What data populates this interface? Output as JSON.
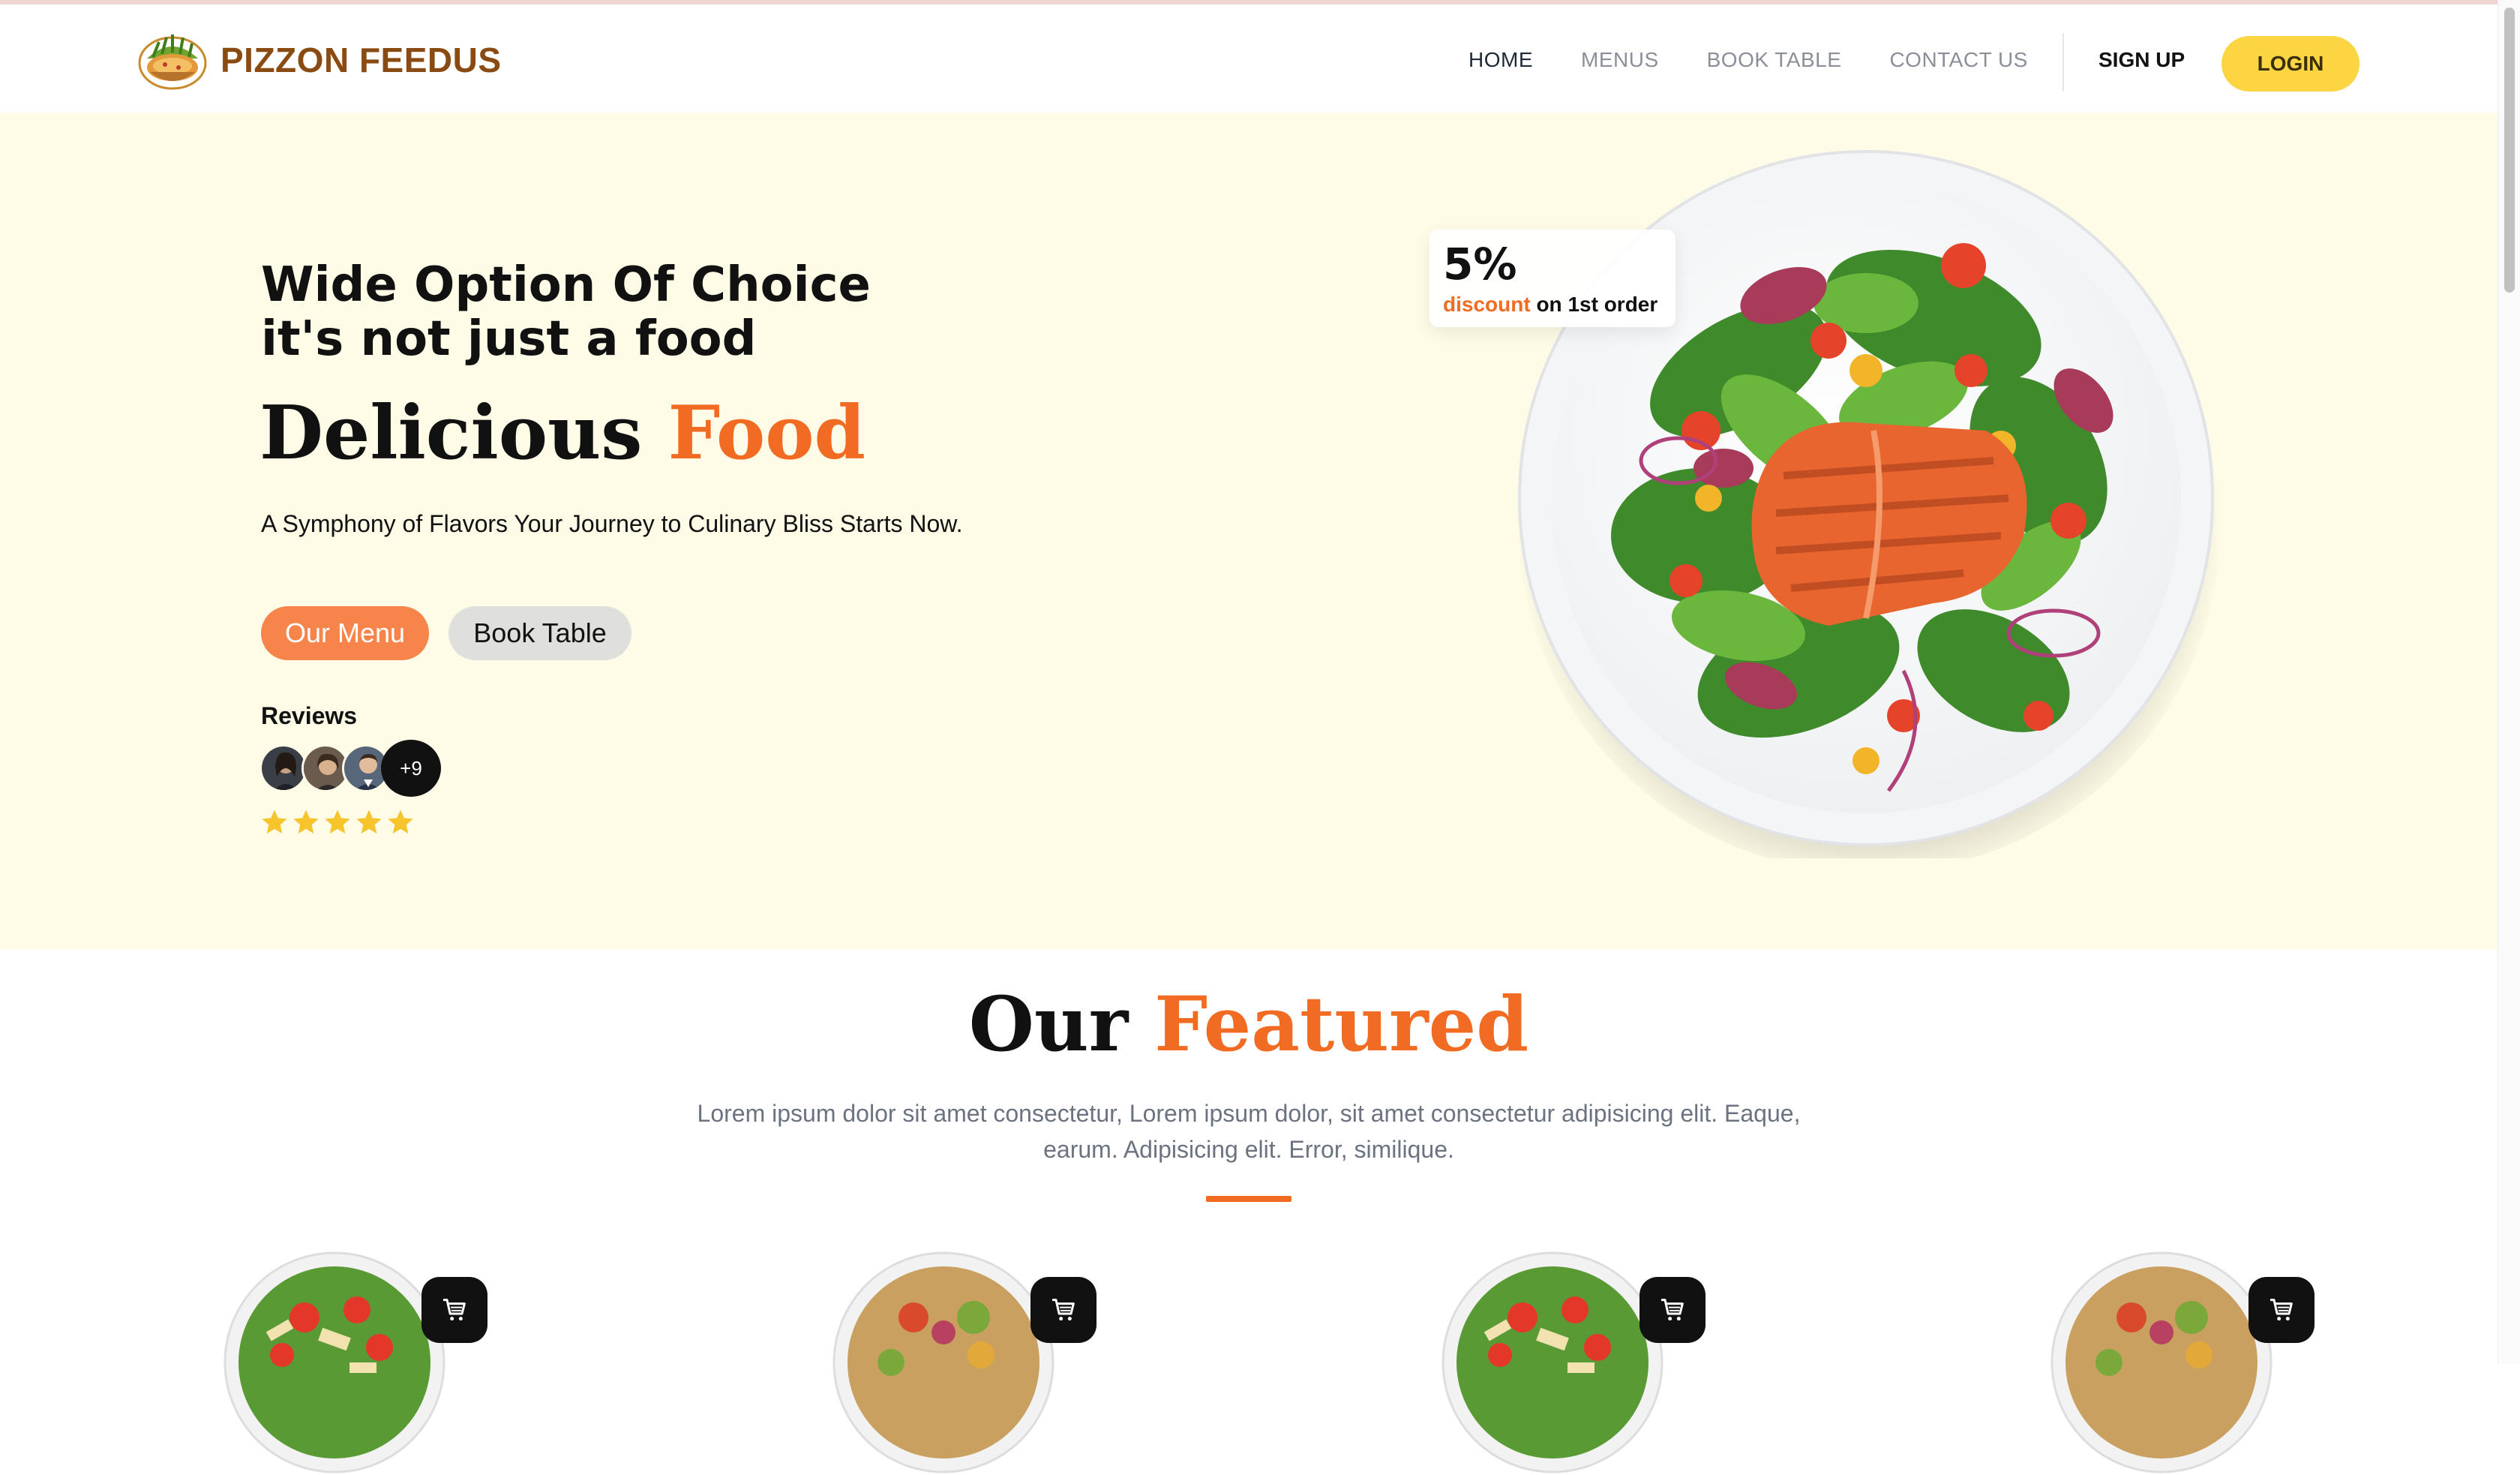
{
  "brand": {
    "name": "PIZZON FEEDUS",
    "logo_icon": "pizza-basket-logo-icon"
  },
  "nav": {
    "links": [
      {
        "label": "HOME",
        "active": true
      },
      {
        "label": "MENUS",
        "active": false
      },
      {
        "label": "BOOK TABLE",
        "active": false
      },
      {
        "label": "CONTACT US",
        "active": false
      }
    ],
    "signup": "SIGN UP",
    "login": "LOGIN"
  },
  "hero": {
    "tagline_1": "Wide Option Of Choice",
    "tagline_2": "it's not just a food",
    "headline_1": "Delicious",
    "headline_2": "Food",
    "subtext": "A Symphony of Flavors Your Journey to Culinary Bliss Starts Now.",
    "btn_menu": "Our Menu",
    "btn_book": "Book Table",
    "reviews_label": "Reviews",
    "reviewers_more": "+9",
    "rating_stars": 5,
    "discount": {
      "pct": "5%",
      "word": "discount",
      "rest": "on 1st order"
    },
    "image": "salmon-salad-plate"
  },
  "featured": {
    "title_1": "Our",
    "title_2": "Featured",
    "description": "Lorem ipsum dolor sit amet consectetur, Lorem ipsum dolor, sit amet consectetur adipisicing elit. Eaque, earum. Adipisicing elit. Error, similique.",
    "cards": [
      {
        "image": "caesar-salad-bowl",
        "cart_icon": "cart-icon"
      },
      {
        "image": "grain-salad-bowl",
        "cart_icon": "cart-icon"
      },
      {
        "image": "caesar-salad-bowl",
        "cart_icon": "cart-icon"
      },
      {
        "image": "grain-salad-bowl",
        "cart_icon": "cart-icon"
      }
    ]
  },
  "colors": {
    "accent": "#f26b22",
    "cream": "#fefbe6",
    "login_yellow": "#fbd542",
    "menu_btn": "#f7844a",
    "star": "#f6c42b"
  }
}
